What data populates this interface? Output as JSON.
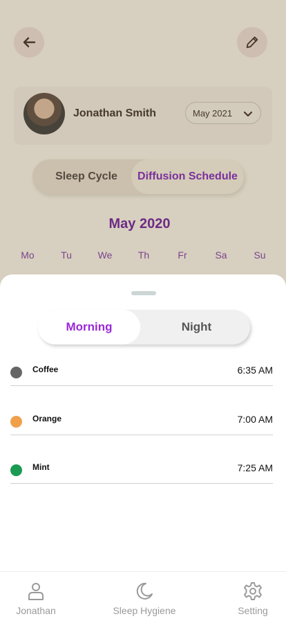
{
  "header": {
    "back_icon": "arrow-left-icon",
    "edit_icon": "pencil-icon"
  },
  "profile": {
    "name": "Jonathan Smith",
    "month_select": "May 2021"
  },
  "top_segment": {
    "options": [
      "Sleep Cycle",
      "Diffusion Schedule"
    ],
    "selected": "Diffusion Schedule"
  },
  "calendar": {
    "month_title": "May 2020",
    "weekdays": [
      "Mo",
      "Tu",
      "We",
      "Th",
      "Fr",
      "Sa",
      "Su"
    ]
  },
  "sheet": {
    "toggle": {
      "morning": "Morning",
      "night": "Night",
      "selected": "Morning"
    },
    "schedule": [
      {
        "name": "Coffee",
        "time": "6:35 AM",
        "color": "#666666"
      },
      {
        "name": "Orange",
        "time": "7:00 AM",
        "color": "#f0a04b"
      },
      {
        "name": "Mint",
        "time": "7:25 AM",
        "color": "#1a9a52"
      }
    ]
  },
  "nav": {
    "items": [
      {
        "label": "Jonathan",
        "icon": "user-icon"
      },
      {
        "label": "Sleep Hygiene",
        "icon": "moon-icon"
      },
      {
        "label": "Setting",
        "icon": "gear-icon"
      }
    ]
  },
  "colors": {
    "accent": "#9c27d8",
    "title_purple": "#6a1b9a"
  }
}
